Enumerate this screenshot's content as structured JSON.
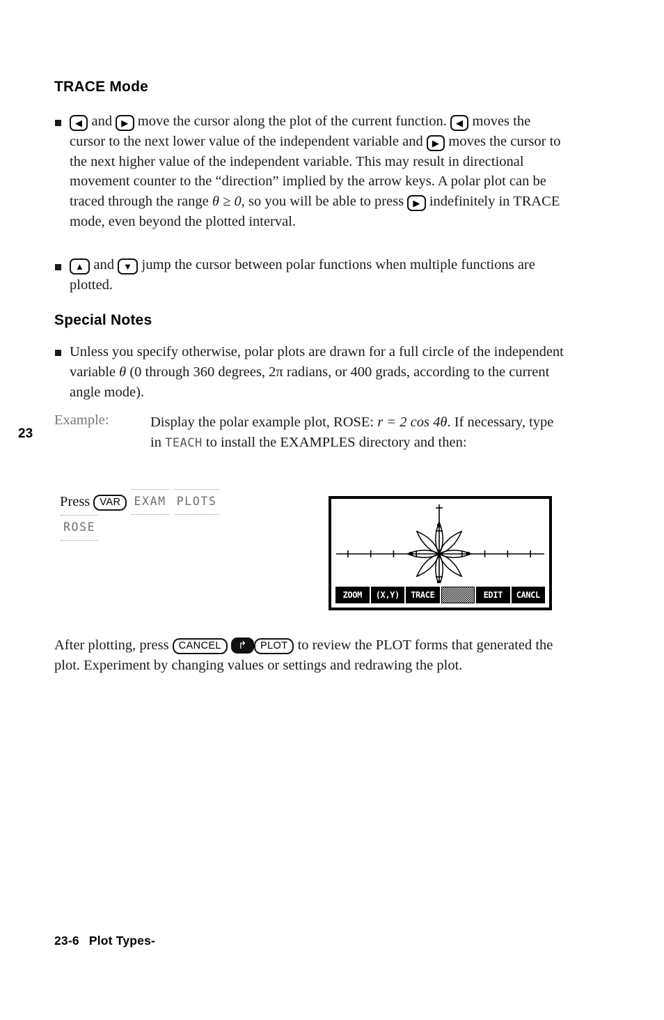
{
  "sections": {
    "trace_mode_heading": "TRACE Mode",
    "special_notes_heading": "Special Notes"
  },
  "bullets": {
    "b1_part1": " and ",
    "b1_part2": " move the cursor along the plot of the current function. ",
    "b1_part3": " moves the cursor to the next lower value of the independent variable and ",
    "b1_part4": " moves the cursor to the next higher value of the independent variable. This may result in directional movement counter to the “direction” implied by the arrow keys. A polar plot can be traced through the range ",
    "b1_theta": "θ ≥ 0",
    "b1_part5": ", so you will be able to press ",
    "b1_part6": " indefinitely in TRACE mode, even beyond the plotted interval.",
    "b2_part1": " and ",
    "b2_part2": " jump the cursor between polar functions when multiple functions are plotted.",
    "b3_part1": "Unless you specify otherwise, polar plots are drawn for a full circle of the independent variable ",
    "b3_theta": "θ",
    "b3_part2": " (0 through 360 degrees, 2π radians, or 400 grads, according to the current angle mode)."
  },
  "keys": {
    "left_arrow": "◀",
    "right_arrow": "▶",
    "up_arrow": "▲",
    "down_arrow": "▼",
    "var": "VAR",
    "cancel": "CANCEL",
    "plot": "PLOT",
    "right_shift": "↱"
  },
  "example": {
    "page_tab": "23",
    "label": "Example:",
    "text_a": "Display the polar example plot, ROSE: ",
    "formula": "r = 2 cos 4θ",
    "text_b": ". If necessary, type in ",
    "teach": "TEACH",
    "text_c": " to install the EXAMPLES directory and then:"
  },
  "press": {
    "label": "Press ",
    "softkeys": [
      "EXAM",
      "PLOTS",
      "ROSE"
    ]
  },
  "calculator": {
    "menu_keys": [
      "ZOOM",
      "(X,Y)",
      "TRACE",
      "",
      "EDIT",
      "CANCL"
    ],
    "menu_blank_index": 3
  },
  "after": {
    "text_a": "After plotting, press ",
    "text_b": " to review the PLOT forms that generated the plot. Experiment by changing values or settings and redrawing the plot."
  },
  "footer": {
    "page": "23-6",
    "title": "Plot Types-"
  },
  "chart_data": {
    "type": "line",
    "title": "ROSE polar plot",
    "equation": "r = 2 cos 4θ",
    "petals": 8,
    "amplitude": 2,
    "theta_range_deg": [
      0,
      360
    ],
    "x_ticks": [
      -5,
      -4,
      -3,
      -2,
      -1,
      1,
      2,
      3,
      4,
      5
    ],
    "y_ticks": [
      -2,
      -1,
      1,
      2
    ],
    "grid": false,
    "axes": true
  }
}
